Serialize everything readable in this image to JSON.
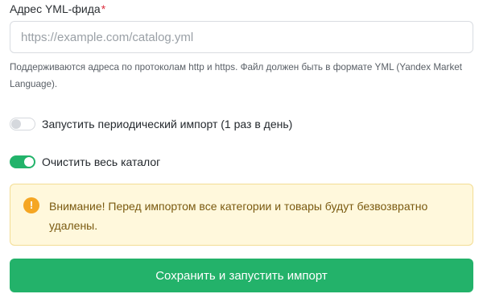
{
  "form": {
    "feed_label": "Адрес YML-фида",
    "required_mark": "*",
    "feed_input": {
      "value": "",
      "placeholder": "https://example.com/catalog.yml"
    },
    "help_text": "Поддерживаются адреса по протоколам http и https. Файл должен быть в формате YML (Yandex Market Language).",
    "periodic_toggle": {
      "label": "Запустить периодический импорт (1 раз в день)",
      "checked": false
    },
    "clear_toggle": {
      "label": "Очистить весь каталог",
      "checked": true
    },
    "warning": {
      "icon": "exclamation-icon",
      "text": "Внимание! Перед импортом все категории и товары будут безвозвратно удалены."
    },
    "submit_label": "Сохранить и запустить импорт"
  },
  "colors": {
    "accent_green": "#23b26a",
    "required_red": "#dc2f3f",
    "warning_bg": "#fff8dc",
    "warning_text": "#7a5a10",
    "warning_icon": "#f5a623"
  }
}
